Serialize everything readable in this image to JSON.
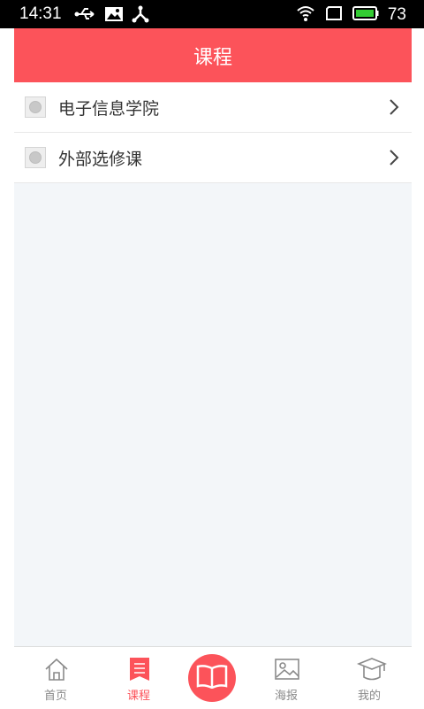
{
  "status_bar": {
    "time": "14:31",
    "battery": "73",
    "icons_left": [
      "usb-icon",
      "image-icon",
      "share-icon"
    ],
    "icons_right": [
      "wifi-icon",
      "signal-icon",
      "battery-icon"
    ]
  },
  "header": {
    "title": "课程"
  },
  "list": {
    "items": [
      {
        "label": "电子信息学院"
      },
      {
        "label": "外部选修课"
      }
    ]
  },
  "tabbar": {
    "tabs": [
      {
        "label": "首页",
        "icon": "home-icon",
        "active": false
      },
      {
        "label": "课程",
        "icon": "list-icon",
        "active": true
      },
      {
        "label": "海报",
        "icon": "picture-icon",
        "active": false
      },
      {
        "label": "我的",
        "icon": "graduation-cap-icon",
        "active": false
      }
    ],
    "center_icon": "book-icon"
  },
  "colors": {
    "accent": "#fc535a",
    "background": "#f3f6f9",
    "text": "#333333",
    "tab_inactive": "#8a8a8a"
  }
}
